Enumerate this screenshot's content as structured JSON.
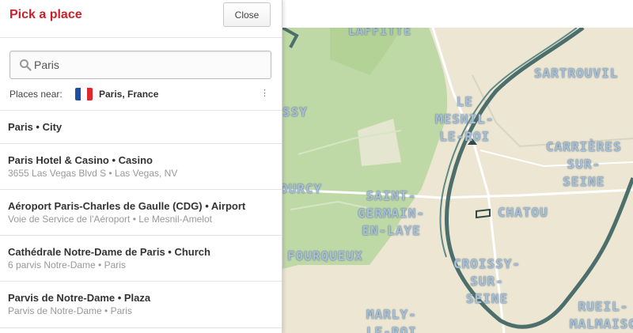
{
  "panel": {
    "title": "Pick a place",
    "close_label": "Close"
  },
  "search": {
    "value": "Paris",
    "icon": "search-icon"
  },
  "places_near": {
    "label": "Places near:",
    "value": "Paris, France",
    "flag_icon": "france-flag-icon",
    "flag_colors": [
      "#1f4fa3",
      "#ffffff",
      "#e2262c"
    ]
  },
  "results": [
    {
      "title": "Paris • City",
      "subtitle": ""
    },
    {
      "title": "Paris Hotel & Casino • Casino",
      "subtitle": "3655 Las Vegas Blvd S • Las Vegas, NV"
    },
    {
      "title": "Aéroport Paris-Charles de Gaulle (CDG) • Airport",
      "subtitle": "Voie de Service de l'Aéroport • Le Mesnil-Amelot"
    },
    {
      "title": "Cathédrale Notre-Dame de Paris • Church",
      "subtitle": "6 parvis Notre-Dame • Paris"
    },
    {
      "title": "Parvis de Notre-Dame • Plaza",
      "subtitle": "Parvis de Notre-Dame • Paris"
    }
  ],
  "map": {
    "labels": {
      "laffitte": "LAFFITTE",
      "sartrouville": "SARTROUVIL",
      "le_mesnil": "LE\nMESNIL-\nLE-ROI",
      "carrieres": "CARRIÈRES\nSUR-\nSEINE",
      "saint_germain": "SAINT-\nGERMAIN-\nEN-LAYE",
      "chatou": "CHATOU",
      "croissy_sur_seine": "CROISSY-\nSUR-\nSEINE",
      "fourqueux": "FOURQUEUX",
      "ourcy": "OURCY",
      "ssy": "SSY",
      "marly": "MARLY-\nLE-ROI",
      "rueil": "RUEIL-\nMALMAISO"
    },
    "colors": {
      "land": "#ece6d2",
      "forest": "#bfd9a6",
      "river": "#4c6f6c",
      "road": "#ffffff",
      "label": "#a9bfd2"
    }
  }
}
